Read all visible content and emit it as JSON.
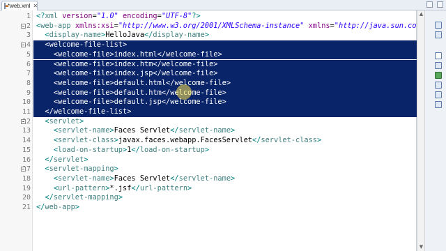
{
  "tab": {
    "label": "*web.xml",
    "close": "✕",
    "icon": "xml-file-icon"
  },
  "lines": [
    {
      "n": "1",
      "fold": false,
      "selected": false,
      "indent": "",
      "tokens": [
        [
          "pi",
          "<?"
        ],
        [
          "t",
          "xml "
        ],
        [
          "a",
          "version"
        ],
        [
          "x",
          "="
        ],
        [
          "v",
          "\"1.0\""
        ],
        [
          "x",
          " "
        ],
        [
          "a",
          "encoding"
        ],
        [
          "x",
          "="
        ],
        [
          "v",
          "\"UTF-8\""
        ],
        [
          "pi",
          "?>"
        ]
      ]
    },
    {
      "n": "2",
      "fold": true,
      "selected": false,
      "indent": "",
      "tokens": [
        [
          "b",
          "<"
        ],
        [
          "t",
          "web-app "
        ],
        [
          "a",
          "xmlns:xsi"
        ],
        [
          "x",
          "="
        ],
        [
          "v",
          "\"http://www.w3.org/2001/XMLSchema-instance\""
        ],
        [
          "x",
          " "
        ],
        [
          "a",
          "xmlns"
        ],
        [
          "x",
          "="
        ],
        [
          "v",
          "\"http://java.sun.co"
        ]
      ]
    },
    {
      "n": "3",
      "fold": false,
      "selected": false,
      "indent": "  ",
      "tokens": [
        [
          "b",
          "<"
        ],
        [
          "t",
          "display-name"
        ],
        [
          "b",
          ">"
        ],
        [
          "x",
          "HelloJava"
        ],
        [
          "b",
          "</"
        ],
        [
          "t",
          "display-name"
        ],
        [
          "b",
          ">"
        ]
      ]
    },
    {
      "n": "4",
      "fold": true,
      "selected": true,
      "indent": "  ",
      "tokens": [
        [
          "b",
          "<"
        ],
        [
          "t",
          "welcome-file-list"
        ],
        [
          "b",
          ">"
        ]
      ]
    },
    {
      "n": "5",
      "fold": false,
      "selected": true,
      "indent": "    ",
      "tokens": [
        [
          "b",
          "<"
        ],
        [
          "t",
          "welcome-file"
        ],
        [
          "b",
          ">"
        ],
        [
          "x",
          "index.html"
        ],
        [
          "b",
          "</"
        ],
        [
          "t",
          "welcome-file"
        ],
        [
          "b",
          ">"
        ]
      ]
    },
    {
      "n": "6",
      "fold": false,
      "selected": true,
      "indent": "    ",
      "tokens": [
        [
          "b",
          "<"
        ],
        [
          "t",
          "welcome-file"
        ],
        [
          "b",
          ">"
        ],
        [
          "x",
          "index.htm"
        ],
        [
          "b",
          "</"
        ],
        [
          "t",
          "welcome-file"
        ],
        [
          "b",
          ">"
        ]
      ]
    },
    {
      "n": "7",
      "fold": false,
      "selected": true,
      "indent": "    ",
      "tokens": [
        [
          "b",
          "<"
        ],
        [
          "t",
          "welcome-file"
        ],
        [
          "b",
          ">"
        ],
        [
          "x",
          "index.jsp"
        ],
        [
          "b",
          "</"
        ],
        [
          "t",
          "welcome-file"
        ],
        [
          "b",
          ">"
        ]
      ]
    },
    {
      "n": "8",
      "fold": false,
      "selected": true,
      "indent": "    ",
      "tokens": [
        [
          "b",
          "<"
        ],
        [
          "t",
          "welcome-file"
        ],
        [
          "b",
          ">"
        ],
        [
          "x",
          "default.html"
        ],
        [
          "b",
          "</"
        ],
        [
          "t",
          "welcome-file"
        ],
        [
          "b",
          ">"
        ]
      ]
    },
    {
      "n": "9",
      "fold": false,
      "selected": true,
      "indent": "    ",
      "tokens": [
        [
          "b",
          "<"
        ],
        [
          "t",
          "welcome-file"
        ],
        [
          "b",
          ">"
        ],
        [
          "x",
          "default.htm"
        ],
        [
          "b",
          "</"
        ],
        [
          "t",
          "welcome-file"
        ],
        [
          "b",
          ">"
        ]
      ]
    },
    {
      "n": "10",
      "fold": false,
      "selected": true,
      "indent": "    ",
      "tokens": [
        [
          "b",
          "<"
        ],
        [
          "t",
          "welcome-file"
        ],
        [
          "b",
          ">"
        ],
        [
          "x",
          "default.jsp"
        ],
        [
          "b",
          "</"
        ],
        [
          "t",
          "welcome-file"
        ],
        [
          "b",
          ">"
        ]
      ]
    },
    {
      "n": "11",
      "fold": false,
      "selected": true,
      "indent": "  ",
      "tokens": [
        [
          "b",
          "</"
        ],
        [
          "t",
          "welcome-file-list"
        ],
        [
          "b",
          ">"
        ]
      ]
    },
    {
      "n": "12",
      "fold": true,
      "selected": false,
      "indent": "  ",
      "tokens": [
        [
          "b",
          "<"
        ],
        [
          "t",
          "servlet"
        ],
        [
          "b",
          ">"
        ]
      ]
    },
    {
      "n": "13",
      "fold": false,
      "selected": false,
      "indent": "    ",
      "tokens": [
        [
          "b",
          "<"
        ],
        [
          "t",
          "servlet-name"
        ],
        [
          "b",
          ">"
        ],
        [
          "x",
          "Faces Servlet"
        ],
        [
          "b",
          "</"
        ],
        [
          "t",
          "servlet-name"
        ],
        [
          "b",
          ">"
        ]
      ]
    },
    {
      "n": "14",
      "fold": false,
      "selected": false,
      "indent": "    ",
      "tokens": [
        [
          "b",
          "<"
        ],
        [
          "t",
          "servlet-class"
        ],
        [
          "b",
          ">"
        ],
        [
          "x",
          "javax.faces.webapp.FacesServlet"
        ],
        [
          "b",
          "</"
        ],
        [
          "t",
          "servlet-class"
        ],
        [
          "b",
          ">"
        ]
      ]
    },
    {
      "n": "15",
      "fold": false,
      "selected": false,
      "indent": "    ",
      "tokens": [
        [
          "b",
          "<"
        ],
        [
          "t",
          "load-on-startup"
        ],
        [
          "b",
          ">"
        ],
        [
          "x",
          "1"
        ],
        [
          "b",
          "</"
        ],
        [
          "t",
          "load-on-startup"
        ],
        [
          "b",
          ">"
        ]
      ]
    },
    {
      "n": "16",
      "fold": false,
      "selected": false,
      "indent": "  ",
      "tokens": [
        [
          "b",
          "</"
        ],
        [
          "t",
          "servlet"
        ],
        [
          "b",
          ">"
        ]
      ]
    },
    {
      "n": "17",
      "fold": true,
      "selected": false,
      "indent": "  ",
      "tokens": [
        [
          "b",
          "<"
        ],
        [
          "t",
          "servlet-mapping"
        ],
        [
          "b",
          ">"
        ]
      ]
    },
    {
      "n": "18",
      "fold": false,
      "selected": false,
      "indent": "    ",
      "tokens": [
        [
          "b",
          "<"
        ],
        [
          "t",
          "servlet-name"
        ],
        [
          "b",
          ">"
        ],
        [
          "x",
          "Faces Servlet"
        ],
        [
          "b",
          "</"
        ],
        [
          "t",
          "servlet-name"
        ],
        [
          "b",
          ">"
        ]
      ]
    },
    {
      "n": "19",
      "fold": false,
      "selected": false,
      "indent": "    ",
      "tokens": [
        [
          "b",
          "<"
        ],
        [
          "t",
          "url-pattern"
        ],
        [
          "b",
          ">"
        ],
        [
          "x",
          "*.jsf"
        ],
        [
          "b",
          "</"
        ],
        [
          "t",
          "url-pattern"
        ],
        [
          "b",
          ">"
        ]
      ]
    },
    {
      "n": "20",
      "fold": false,
      "selected": false,
      "indent": "  ",
      "tokens": [
        [
          "b",
          "</"
        ],
        [
          "t",
          "servlet-mapping"
        ],
        [
          "b",
          ">"
        ]
      ]
    },
    {
      "n": "21",
      "fold": false,
      "selected": false,
      "indent": "",
      "tokens": [
        [
          "b",
          "</"
        ],
        [
          "t",
          "web-app"
        ],
        [
          "b",
          ">"
        ]
      ]
    }
  ],
  "toolbar_icons": [
    "minimize-icon",
    "maximize-icon",
    "outline-icon",
    "task-list-icon",
    "console-icon",
    "problems-icon",
    "servers-icon",
    "properties-icon",
    "search-icon",
    "history-icon"
  ],
  "colors": {
    "selection": "#0a246a",
    "tag": "#3f7f7f",
    "attribute": "#7f007f",
    "value": "#2a00ff"
  }
}
